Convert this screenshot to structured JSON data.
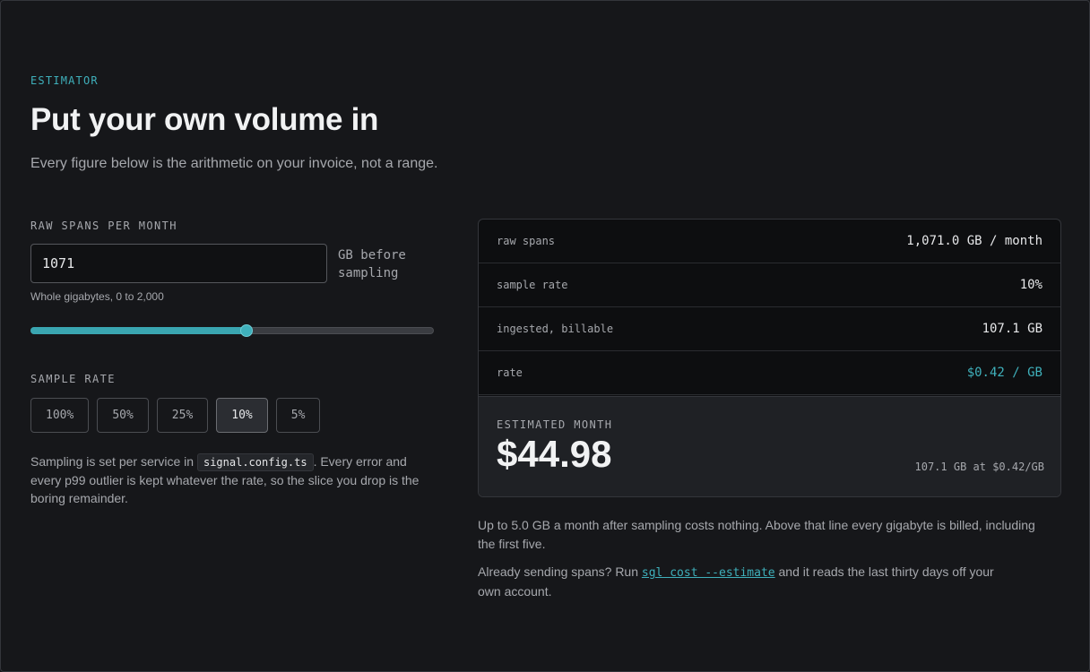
{
  "header": {
    "eyebrow": "ESTIMATOR",
    "title": "Put your own volume in",
    "subtitle": "Every figure below is the arithmetic on your invoice, not a range."
  },
  "volume": {
    "label": "RAW SPANS PER MONTH",
    "value": "1071",
    "unit_hint": "GB before sampling",
    "help": "Whole gigabytes, 0 to 2,000",
    "slider": {
      "min": 0,
      "max": 2000,
      "value": 1071
    }
  },
  "sample_rate": {
    "label": "SAMPLE RATE",
    "options": [
      "100%",
      "50%",
      "25%",
      "10%",
      "5%"
    ],
    "selected": "10%"
  },
  "note": {
    "before": "Sampling is set per service in ",
    "code": "signal.config.ts",
    "after": ". Every error and every p99 outlier is kept whatever the rate, so the slice you drop is the boring remainder."
  },
  "summary": {
    "rows": [
      {
        "label": "raw spans",
        "value": "1,071.0 GB / month"
      },
      {
        "label": "sample rate",
        "value": "10%"
      },
      {
        "label": "ingested, billable",
        "value": "107.1 GB"
      },
      {
        "label": "rate",
        "value": "$0.42 / GB"
      }
    ],
    "total_label": "ESTIMATED MONTH",
    "total_amount": "$44.98",
    "total_breakdown": "107.1 GB at $0.42/GB"
  },
  "footer": {
    "free_tier": "Up to 5.0 GB a month after sampling costs nothing. Above that line every gigabyte is billed, including the first five.",
    "cli_before": "Already sending spans? Run ",
    "cli_command": "sgl cost --estimate",
    "cli_after": " and it reads the last thirty days off your own account."
  },
  "colors": {
    "accent": "#3fb0bb",
    "background": "#16171a",
    "panel": "#0d0e10"
  }
}
